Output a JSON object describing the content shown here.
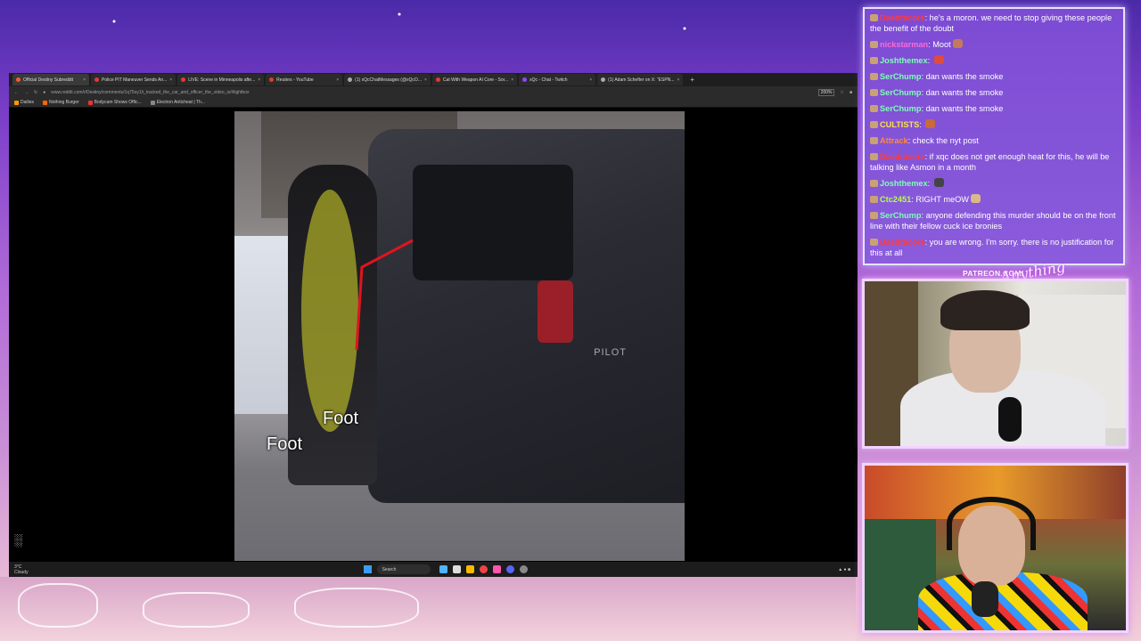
{
  "browser": {
    "tabs": [
      {
        "label": "Official Destiny Subreddit",
        "active": true,
        "color": "#ff5a2a"
      },
      {
        "label": "Police PIT Maneuver Sends An...",
        "active": false,
        "color": "#e53935"
      },
      {
        "label": "LIVE: Scene in Minneapolis afte...",
        "active": false,
        "color": "#e53935"
      },
      {
        "label": "Reuters - YouTube",
        "active": false,
        "color": "#e53935"
      },
      {
        "label": "(1) xQcChatMessages (@xQcO...",
        "active": false,
        "color": "#aaaaaa"
      },
      {
        "label": "Cat With Weapon AI Core - Sor...",
        "active": false,
        "color": "#e53935"
      },
      {
        "label": "xQc - Chat - Twitch",
        "active": false,
        "color": "#9146ff"
      },
      {
        "label": "(1) Adam Schefter on X: \"ESPN...",
        "active": false,
        "color": "#aaaaaa"
      }
    ],
    "url": "www.reddit.com/r/Destiny/comments/1q75oy1/i_tracked_the_car_and_officer_the_video_is/#lightbox",
    "zoom": "200%",
    "bookmarks": [
      "Dailies",
      "Nothing Burger",
      "Bodycam Shows Offic...",
      "Electron Anticheat | Th..."
    ]
  },
  "video": {
    "labels": [
      "Foot",
      "Foot"
    ],
    "plate_text": "PILOT"
  },
  "taskbar": {
    "weather_temp": "3°C",
    "weather_desc": "Cloudy",
    "search": "Search"
  },
  "chat": {
    "messages": [
      {
        "user": "Daedracore",
        "color": "#ff3b3b",
        "text": "he's a moron. we need to stop giving these people the benefit of the doubt"
      },
      {
        "user": "nickstarman",
        "color": "#ff6ad5",
        "text": "Moot",
        "emote": "#c47a5a"
      },
      {
        "user": "Joshthemex",
        "color": "#7dffb7",
        "text": "",
        "emote": "#e04b3b"
      },
      {
        "user": "SerChump",
        "color": "#7dffb7",
        "text": "dan wants the smoke"
      },
      {
        "user": "SerChump",
        "color": "#7dffb7",
        "text": "dan wants the smoke"
      },
      {
        "user": "SerChump",
        "color": "#7dffb7",
        "text": "dan wants the smoke"
      },
      {
        "user": "CULTISTS",
        "color": "#ffe14a",
        "text": "",
        "emote": "#c96a3a"
      },
      {
        "user": "Attrack",
        "color": "#ff8a3d",
        "text": "check the nyt post"
      },
      {
        "user": "Daedracore",
        "color": "#ff3b3b",
        "text": "if xqc does not get enough heat for this, he will be talking like Asmon in a month"
      },
      {
        "user": "Joshthemex",
        "color": "#7dffb7",
        "text": "",
        "emote": "#444444"
      },
      {
        "user": "Ctc2451",
        "color": "#b6ff4a",
        "text": "RIGHT meOW",
        "emote": "#d9b98a"
      },
      {
        "user": "SerChump",
        "color": "#7dffb7",
        "text": "anyone defending this murder should be on the front line with their fellow cuck ice bronies"
      },
      {
        "user": "Daedracore",
        "color": "#ff3b3b",
        "text": "you are wrong. I'm sorry. there is no justification for this at all"
      }
    ]
  },
  "overlay": {
    "patreon": "PATREON.COM/",
    "signature": "Anything"
  }
}
